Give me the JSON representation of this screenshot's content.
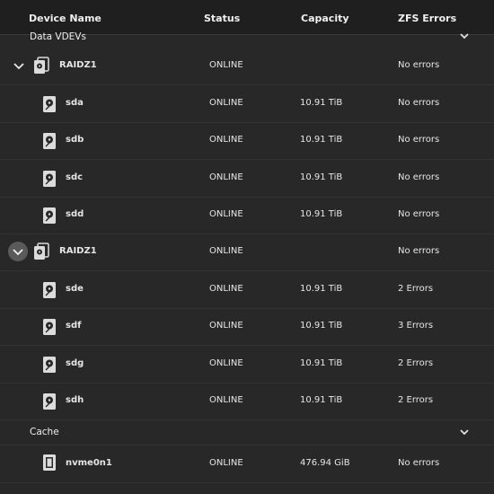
{
  "columns": {
    "device_name": "Device Name",
    "status": "Status",
    "capacity": "Capacity",
    "zfs_errors": "ZFS Errors"
  },
  "sections": {
    "data_vdevs": "Data VDEVs",
    "cache": "Cache"
  },
  "rows": [
    {
      "name": "RAIDZ1",
      "status": "ONLINE",
      "capacity": "",
      "errors": "No errors"
    },
    {
      "name": "sda",
      "status": "ONLINE",
      "capacity": "10.91 TiB",
      "errors": "No errors"
    },
    {
      "name": "sdb",
      "status": "ONLINE",
      "capacity": "10.91 TiB",
      "errors": "No errors"
    },
    {
      "name": "sdc",
      "status": "ONLINE",
      "capacity": "10.91 TiB",
      "errors": "No errors"
    },
    {
      "name": "sdd",
      "status": "ONLINE",
      "capacity": "10.91 TiB",
      "errors": "No errors"
    },
    {
      "name": "RAIDZ1",
      "status": "ONLINE",
      "capacity": "",
      "errors": "No errors"
    },
    {
      "name": "sde",
      "status": "ONLINE",
      "capacity": "10.91 TiB",
      "errors": "2 Errors"
    },
    {
      "name": "sdf",
      "status": "ONLINE",
      "capacity": "10.91 TiB",
      "errors": "3 Errors"
    },
    {
      "name": "sdg",
      "status": "ONLINE",
      "capacity": "10.91 TiB",
      "errors": "2 Errors"
    },
    {
      "name": "sdh",
      "status": "ONLINE",
      "capacity": "10.91 TiB",
      "errors": "2 Errors"
    },
    {
      "name": "nvme0n1",
      "status": "ONLINE",
      "capacity": "476.94 GiB",
      "errors": "No errors"
    }
  ],
  "icons": {
    "expand": "chevron-down-icon",
    "vdev": "vdev-stack-icon",
    "disk": "hard-disk-icon",
    "ssd": "ssd-chip-icon"
  }
}
